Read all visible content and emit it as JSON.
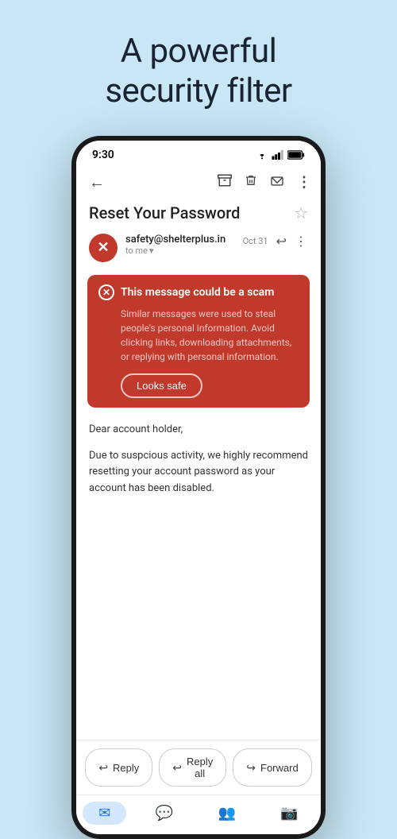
{
  "hero": {
    "title_line1": "A powerful",
    "title_line2": "security filter"
  },
  "status_bar": {
    "time": "9:30"
  },
  "toolbar": {
    "back_label": "←",
    "icons": [
      "archive",
      "delete",
      "mail",
      "more"
    ]
  },
  "email": {
    "subject": "Reset Your Password",
    "sender": "safety@shelterplus.in",
    "date": "Oct 31",
    "to": "to me"
  },
  "warning": {
    "title": "This message could be a scam",
    "body": "Similar messages were used to steal people's personal information. Avoid clicking links, downloading attachments, or replying with personal information.",
    "button_label": "Looks safe"
  },
  "email_body": {
    "line1": "Dear account holder,",
    "line2": "Due to suspcious activity, we highly recommend resetting your account password as your account has been disabled."
  },
  "actions": {
    "reply_label": "Reply",
    "reply_all_label": "Reply all",
    "forward_label": "Forward"
  },
  "bottom_nav": {
    "items": [
      "mail",
      "chat",
      "people",
      "video"
    ]
  }
}
